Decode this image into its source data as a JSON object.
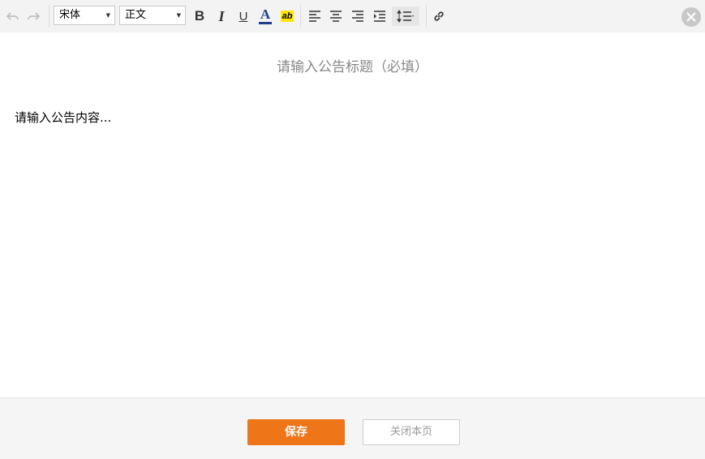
{
  "toolbar": {
    "font_family": {
      "value": "宋体"
    },
    "paragraph_style": {
      "value": "正文"
    },
    "icons": {
      "undo": "undo-icon",
      "redo": "redo-icon",
      "bold": "bold-icon",
      "italic": "italic-icon",
      "underline": "underline-icon",
      "font_color": "font-color-icon",
      "highlight": "highlight-icon",
      "align_left": "align-left-icon",
      "align_center": "align-center-icon",
      "align_right": "align-right-icon",
      "indent": "indent-icon",
      "line_height": "line-height-icon",
      "link": "link-icon",
      "close": "close-icon"
    },
    "bold_glyph": "B",
    "italic_glyph": "I",
    "underline_glyph": "U",
    "font_color_glyph": "A",
    "highlight_glyph": "ab",
    "colors": {
      "font_color_bar": "#1f3d8c",
      "highlight_bg": "#ffe600"
    }
  },
  "editor": {
    "title_placeholder": "请输入公告标题（必填）",
    "content_placeholder": "请输入公告内容..."
  },
  "footer": {
    "save_label": "保存",
    "close_label": "关闭本页"
  },
  "colors": {
    "accent": "#ef7519"
  }
}
